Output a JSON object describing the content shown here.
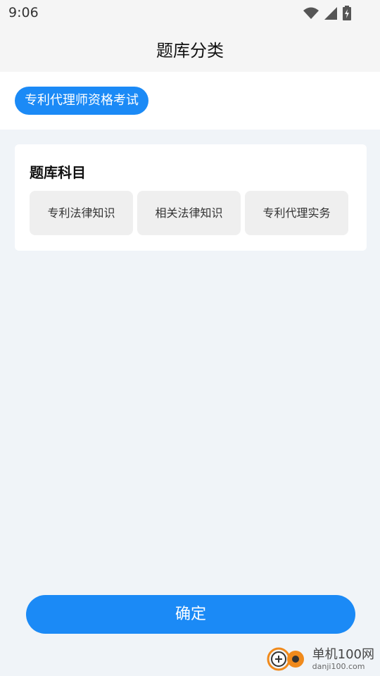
{
  "status_bar": {
    "time": "9:06",
    "icons": [
      "wifi-icon",
      "signal-icon",
      "battery-charging-icon"
    ]
  },
  "header": {
    "title": "题库分类"
  },
  "category": {
    "selected_label": "专利代理师资格考试",
    "accent": "#1b8af6"
  },
  "subjects": {
    "title": "题库科目",
    "options": [
      {
        "label": "专利法律知识"
      },
      {
        "label": "相关法律知识"
      },
      {
        "label": "专利代理实务"
      }
    ]
  },
  "confirm": {
    "label": "确定"
  },
  "watermark": {
    "brand": "单机100网",
    "url": "danji100.com"
  }
}
